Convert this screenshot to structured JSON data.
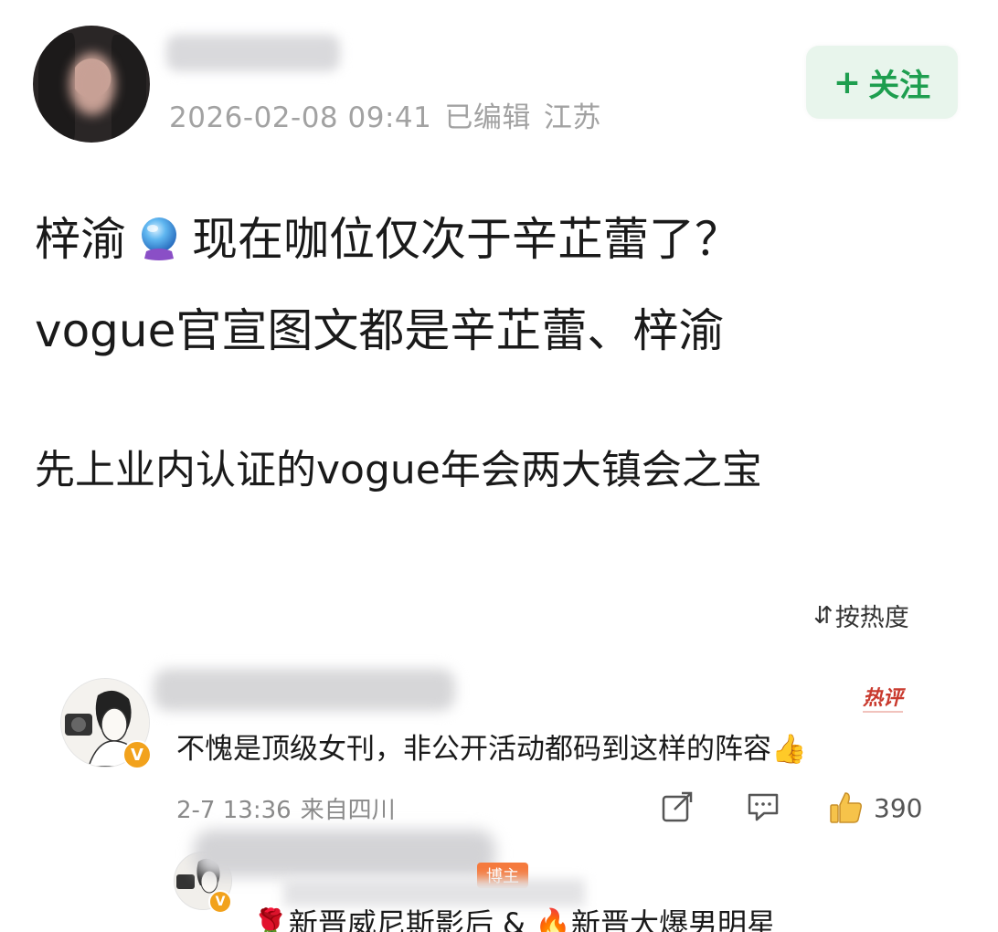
{
  "post": {
    "timestamp": "2026-02-08 09:41",
    "edited_label": "已编辑",
    "location": "江苏",
    "follow_label": "关注",
    "line1_prefix": "梓渝",
    "line1_suffix": "现在咖位仅次于辛芷蕾了？",
    "line2": "vogue官宣图文都是辛芷蕾、梓渝",
    "line3": "先上业内认证的vogue年会两大镇会之宝",
    "emoji_icon": "crystal-ball-icon"
  },
  "sort": {
    "label": "按热度"
  },
  "comment": {
    "hot_label": "热评",
    "text": "不愧是顶级女刊，非公开活动都码到这样的阵容👍",
    "time": "2-7 13:36",
    "source": "来自四川",
    "like_count": "390"
  },
  "reply": {
    "op_label": "博主",
    "text": "🌹新晋威尼斯影后 & 🔥新晋大爆男明星"
  },
  "colors": {
    "follow_green": "#1e9e4f",
    "follow_bg": "#e8f5ec",
    "hot_red": "#c93a2e",
    "vip_orange": "#f2a21c"
  }
}
